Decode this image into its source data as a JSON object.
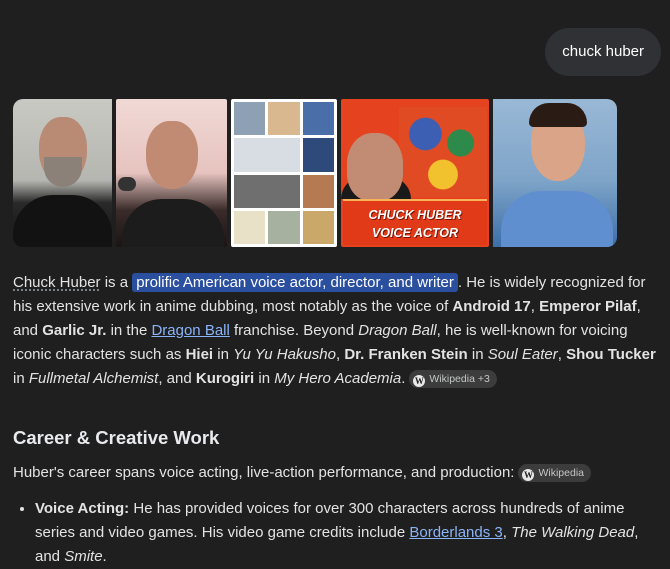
{
  "query": "chuck huber",
  "images": {
    "caption_line1": "CHUCK HUBER",
    "caption_line2": "VOICE ACTOR"
  },
  "intro": {
    "name": "Chuck Huber",
    "is_a": " is a ",
    "highlight": "prolific American voice actor, director, and writer",
    "t1": ". He is widely recognized for his extensive work in anime dubbing, most notably as the voice of ",
    "b1": "Android 17",
    "t2": ", ",
    "b2": "Emperor Pilaf",
    "t3": ", and ",
    "b3": "Garlic Jr.",
    "t4": " in the ",
    "link1": "Dragon Ball",
    "t5": " franchise. Beyond ",
    "i1": "Dragon Ball",
    "t6": ", he is well-known for voicing iconic characters such as ",
    "b4": "Hiei",
    "t7": " in ",
    "i2": "Yu Yu Hakusho",
    "t8": ", ",
    "b5": "Dr. Franken Stein",
    "t9": " in ",
    "i3": "Soul Eater",
    "t10": ", ",
    "b6": "Shou Tucker",
    "t11": " in ",
    "i4": "Fullmetal Alchemist",
    "t12": ", and ",
    "b7": "Kurogiri",
    "t13": " in ",
    "i5": "My Hero Academia",
    "t14": ".",
    "source_chip": "Wikipedia +3"
  },
  "career": {
    "heading": "Career & Creative Work",
    "summary": "Huber's career spans voice acting, live-action performance, and production:",
    "source_chip": "Wikipedia",
    "bullet1": {
      "label": "Voice Acting:",
      "t1": " He has provided voices for over 300 characters across hundreds of anime series and video games. His video game credits include ",
      "link": "Borderlands 3",
      "t2": ", ",
      "i1": "The Walking Dead",
      "t3": ", and ",
      "i2": "Smite",
      "t4": "."
    }
  },
  "icons": {
    "source": "wikipedia-w-icon"
  },
  "colors": {
    "background": "#1f1f1f",
    "highlight": "#2a4f9e",
    "link": "#8ab4f8",
    "chip": "#3c3c3c"
  }
}
